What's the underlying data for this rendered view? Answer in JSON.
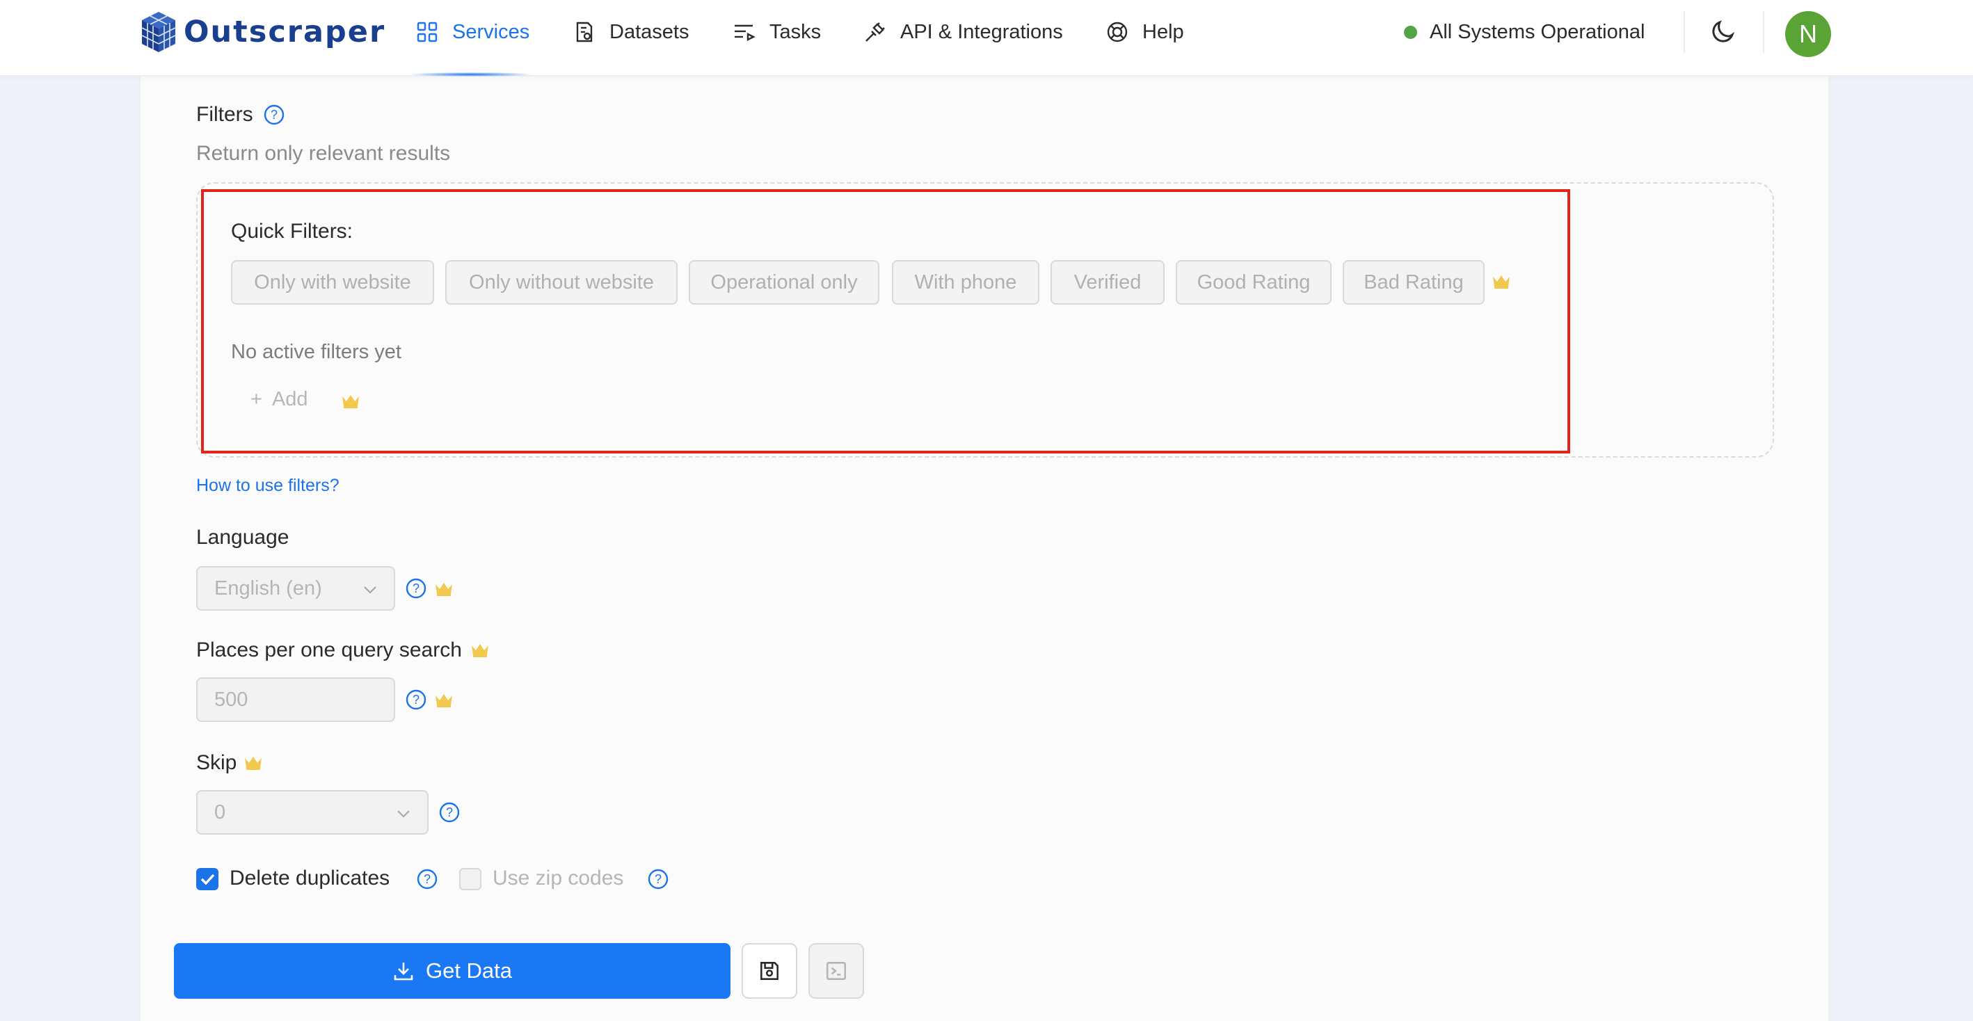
{
  "header": {
    "logo_text": "Outscraper",
    "nav": [
      {
        "label": "Services",
        "icon": "grid-icon",
        "active": true
      },
      {
        "label": "Datasets",
        "icon": "document-icon"
      },
      {
        "label": "Tasks",
        "icon": "task-list-icon"
      },
      {
        "label": "API & Integrations",
        "icon": "plug-icon"
      },
      {
        "label": "Help",
        "icon": "lifebuoy-icon"
      }
    ],
    "status_text": "All Systems Operational",
    "status_color": "#52a447",
    "avatar_initial": "N",
    "avatar_color": "#5aa335"
  },
  "filters": {
    "title": "Filters",
    "subtitle": "Return only relevant results",
    "quick_title": "Quick Filters:",
    "quick_chips": [
      "Only with website",
      "Only without website",
      "Operational only",
      "With phone",
      "Verified",
      "Good Rating",
      "Bad Rating"
    ],
    "no_filters": "No active filters yet",
    "add_label": "Add",
    "help_link": "How to use filters?"
  },
  "language": {
    "label": "Language",
    "value": "English (en)"
  },
  "places": {
    "label": "Places per one query search",
    "value": "500"
  },
  "skip": {
    "label": "Skip",
    "value": "0"
  },
  "options": {
    "delete_duplicates": {
      "label": "Delete duplicates",
      "checked": true
    },
    "use_zip_codes": {
      "label": "Use zip codes",
      "checked": false
    }
  },
  "actions": {
    "get_data": "Get Data"
  },
  "colors": {
    "accent": "#1c73e8",
    "crown": "#f2c94c",
    "highlight_frame": "#e1251b"
  }
}
